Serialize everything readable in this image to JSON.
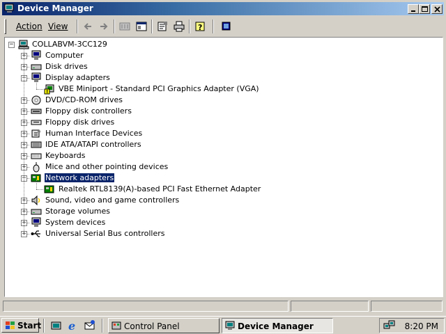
{
  "window": {
    "title": "Device Manager"
  },
  "menu": {
    "action": "Action",
    "view": "View"
  },
  "tree": {
    "root": "COLLABVM-3CC129",
    "categories": [
      {
        "label": "Computer",
        "icon": "computer-icon",
        "expanded": false
      },
      {
        "label": "Disk drives",
        "icon": "disk-drive-icon",
        "expanded": false
      },
      {
        "label": "Display adapters",
        "icon": "monitor-icon",
        "expanded": true,
        "children": [
          {
            "label": "VBE Miniport - Standard PCI Graphics Adapter (VGA)",
            "icon": "warning-display-icon"
          }
        ]
      },
      {
        "label": "DVD/CD-ROM drives",
        "icon": "cdrom-icon",
        "expanded": false
      },
      {
        "label": "Floppy disk controllers",
        "icon": "controller-icon",
        "expanded": false
      },
      {
        "label": "Floppy disk drives",
        "icon": "floppy-icon",
        "expanded": false
      },
      {
        "label": "Human Interface Devices",
        "icon": "hid-icon",
        "expanded": false
      },
      {
        "label": "IDE ATA/ATAPI controllers",
        "icon": "ide-icon",
        "expanded": false
      },
      {
        "label": "Keyboards",
        "icon": "keyboard-icon",
        "expanded": false
      },
      {
        "label": "Mice and other pointing devices",
        "icon": "mouse-icon",
        "expanded": false
      },
      {
        "label": "Network adapters",
        "icon": "network-card-icon",
        "expanded": true,
        "selected": true,
        "children": [
          {
            "label": "Realtek RTL8139(A)-based PCI Fast Ethernet Adapter",
            "icon": "network-card-icon"
          }
        ]
      },
      {
        "label": "Sound, video and game controllers",
        "icon": "sound-icon",
        "expanded": false
      },
      {
        "label": "Storage volumes",
        "icon": "storage-icon",
        "expanded": false
      },
      {
        "label": "System devices",
        "icon": "system-icon",
        "expanded": false
      },
      {
        "label": "Universal Serial Bus controllers",
        "icon": "usb-icon",
        "expanded": false
      }
    ]
  },
  "taskbar": {
    "start_label": "Start",
    "tasks": [
      {
        "label": "Control Panel",
        "active": false
      },
      {
        "label": "Device Manager",
        "active": true
      }
    ],
    "clock": "8:20 PM"
  },
  "colors": {
    "title_active": "#0a246a",
    "selection": "#0a246a",
    "face": "#d4d0c8"
  }
}
